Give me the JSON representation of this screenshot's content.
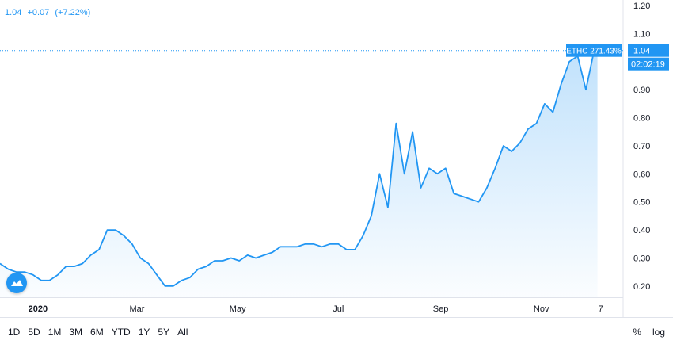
{
  "header": {
    "price": "1.04",
    "change": "+0.07",
    "change_pct": "(+7.22%)"
  },
  "price_axis": {
    "ticks": [
      "1.20",
      "1.10",
      "1.00",
      "0.90",
      "0.80",
      "0.70",
      "0.60",
      "0.50",
      "0.40",
      "0.30",
      "0.20"
    ],
    "last_price_tag": "1.04",
    "countdown_tag": "02:02:19",
    "series_tag": "ETHC 271.43%"
  },
  "time_axis": {
    "ticks": [
      "2020",
      "Mar",
      "May",
      "Jul",
      "Sep",
      "Nov",
      "7"
    ]
  },
  "toolbar": {
    "ranges": [
      "1D",
      "5D",
      "1M",
      "3M",
      "6M",
      "YTD",
      "1Y",
      "5Y",
      "All"
    ],
    "percent_label": "%",
    "log_label": "log"
  },
  "colors": {
    "line": "#2196f3",
    "tag": "#2196f3"
  },
  "chart_data": {
    "type": "area",
    "series": [
      {
        "name": "ETHC",
        "x": [
          "2019-12-09",
          "2019-12-14",
          "2019-12-19",
          "2019-12-24",
          "2019-12-29",
          "2020-01-03",
          "2020-01-08",
          "2020-01-13",
          "2020-01-18",
          "2020-01-23",
          "2020-01-28",
          "2020-02-02",
          "2020-02-07",
          "2020-02-12",
          "2020-02-17",
          "2020-02-22",
          "2020-02-27",
          "2020-03-03",
          "2020-03-08",
          "2020-03-13",
          "2020-03-18",
          "2020-03-23",
          "2020-03-28",
          "2020-04-02",
          "2020-04-07",
          "2020-04-12",
          "2020-04-17",
          "2020-04-22",
          "2020-04-27",
          "2020-05-02",
          "2020-05-07",
          "2020-05-12",
          "2020-05-17",
          "2020-05-22",
          "2020-05-27",
          "2020-06-01",
          "2020-06-06",
          "2020-06-11",
          "2020-06-16",
          "2020-06-21",
          "2020-06-26",
          "2020-07-01",
          "2020-07-06",
          "2020-07-11",
          "2020-07-16",
          "2020-07-21",
          "2020-07-26",
          "2020-07-31",
          "2020-08-05",
          "2020-08-10",
          "2020-08-15",
          "2020-08-20",
          "2020-08-25",
          "2020-08-30",
          "2020-09-04",
          "2020-09-09",
          "2020-09-14",
          "2020-09-19",
          "2020-09-24",
          "2020-09-29",
          "2020-10-04",
          "2020-10-09",
          "2020-10-14",
          "2020-10-19",
          "2020-10-24",
          "2020-10-29",
          "2020-11-03",
          "2020-11-08",
          "2020-11-13",
          "2020-11-18",
          "2020-11-23",
          "2020-11-28",
          "2020-12-03",
          "2020-12-05"
        ],
        "values": [
          0.28,
          0.26,
          0.25,
          0.25,
          0.24,
          0.22,
          0.22,
          0.24,
          0.27,
          0.27,
          0.28,
          0.31,
          0.33,
          0.4,
          0.4,
          0.38,
          0.35,
          0.3,
          0.28,
          0.24,
          0.2,
          0.2,
          0.22,
          0.23,
          0.26,
          0.27,
          0.29,
          0.29,
          0.3,
          0.29,
          0.31,
          0.3,
          0.31,
          0.32,
          0.34,
          0.34,
          0.34,
          0.35,
          0.35,
          0.34,
          0.35,
          0.35,
          0.33,
          0.33,
          0.38,
          0.45,
          0.6,
          0.48,
          0.78,
          0.6,
          0.75,
          0.55,
          0.62,
          0.6,
          0.62,
          0.53,
          0.52,
          0.51,
          0.5,
          0.55,
          0.62,
          0.7,
          0.68,
          0.71,
          0.76,
          0.78,
          0.85,
          0.82,
          0.92,
          1.0,
          1.02,
          0.9,
          1.04,
          1.04
        ]
      }
    ],
    "ylim": [
      0.16,
      1.22
    ],
    "xlim": [
      "2019-12-09",
      "2020-12-10"
    ],
    "grid": false,
    "legend": "none"
  }
}
